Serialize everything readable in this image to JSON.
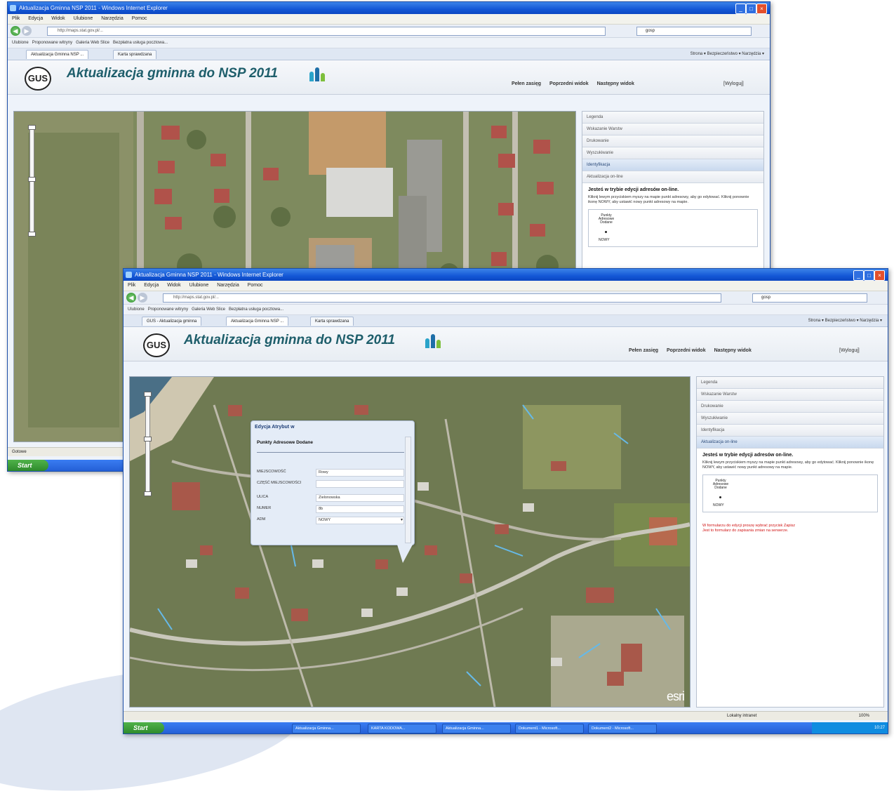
{
  "back_window": {
    "title": "Aktualizacja Gminna NSP 2011 - Windows Internet Explorer",
    "menu": [
      "Plik",
      "Edycja",
      "Widok",
      "Ulubione",
      "Narzędzia",
      "Pomoc"
    ],
    "address": "http://maps.stat.gov.pl/...",
    "search_text": "gosp",
    "favorites": [
      "Ulubione",
      "Proponowane witryny",
      "Galeria Web Slice",
      "Bezpłatna usługa pocztowa..."
    ],
    "tab": "Aktualizacja Gminna NSP ...",
    "tab2": "Karta sprawdzana",
    "tools": "Strona ▾  Bezpieczeństwo ▾  Narzędzia ▾",
    "app_title": "Aktualizacja gminna do NSP 2011",
    "links": [
      "Pełen zasięg",
      "Poprzedni widok",
      "Następny widok"
    ],
    "logout": "[Wyloguj]",
    "accordion": [
      "Legenda",
      "Wskazanie Warstw",
      "Drukowanie",
      "Wyszukiwanie",
      "Identyfikacja",
      "Aktualizacja on-line"
    ],
    "panel_title": "Jesteś w trybie edycji adresów on-line.",
    "panel_text": "Kliknij lewym przyciskiem myszy na mapie punkt adresowy, aby go edytować. Kliknij ponownie ikonę NOWY, aby ustawić nowy punkt adresowy na mapie.",
    "legend_label": "Punkty Adresowe Dodane",
    "legend_item": "NOWY",
    "status": "Gotowe",
    "start": "Start"
  },
  "front_window": {
    "title": "Aktualizacja Gminna NSP 2011 - Windows Internet Explorer",
    "menu": [
      "Plik",
      "Edycja",
      "Widok",
      "Ulubione",
      "Narzędzia",
      "Pomoc"
    ],
    "address": "http://maps.stat.gov.pl/...",
    "search_text": "gosp",
    "favorites": [
      "Ulubione",
      "Proponowane witryny",
      "Galeria Web Slice",
      "Bezpłatna usługa pocztowa..."
    ],
    "tabs": [
      "GUS - Aktualizacja gminna",
      "Aktualizacja Gminna NSP ...",
      "Karta sprawdzana"
    ],
    "tools": "Strona ▾  Bezpieczeństwo ▾  Narzędzia ▾",
    "app_title": "Aktualizacja gminna do NSP 2011",
    "links": [
      "Pełen zasięg",
      "Poprzedni widok",
      "Następny widok"
    ],
    "logout": "[Wyloguj]",
    "accordion": [
      "Legenda",
      "Wskazanie Warstw",
      "Drukowanie",
      "Wyszukiwanie",
      "Identyfikacja",
      "Aktualizacja on-line"
    ],
    "panel_title": "Jesteś w trybie edycji adresów on-line.",
    "panel_text": "Kliknij lewym przyciskiem myszy na mapie punkt adresowy, aby go edytować. Kliknij ponownie ikonę NOWY, aby ustawić nowy punkt adresowy na mapie.",
    "legend_label": "Punkty Adresowe Dodane",
    "legend_item": "NOWY",
    "red_text_1": "W formularzu do edycji proszę wybrać przycisk Zapisz",
    "red_text_2": "Jest to formularz do zapisania zmian na serwerze.",
    "popup": {
      "header": "Edycja Atrybut w",
      "subheader": "Punkty Adresowe Dodane",
      "fields": [
        {
          "label": "MIEJSCOWOŚĆ",
          "value": "Rowy"
        },
        {
          "label": "CZĘŚĆ MIEJSCOWOŚCI",
          "value": ""
        },
        {
          "label": "ULICA",
          "value": "Zielonowska"
        },
        {
          "label": "NUMER",
          "value": "8b"
        },
        {
          "label": "ADM",
          "value": "NOWY"
        }
      ]
    },
    "esri": "esri",
    "status_zone": "Lokalny intranet",
    "zoom": "100%",
    "start": "Start",
    "taskbar_items": [
      "Aktualizacja Gminna...",
      "KARTA KODOWA...",
      "Aktualizacja Gminna...",
      "Dokument1 - Microsoft...",
      "Dokument2 - Microsoft..."
    ],
    "clock": "10:27"
  }
}
